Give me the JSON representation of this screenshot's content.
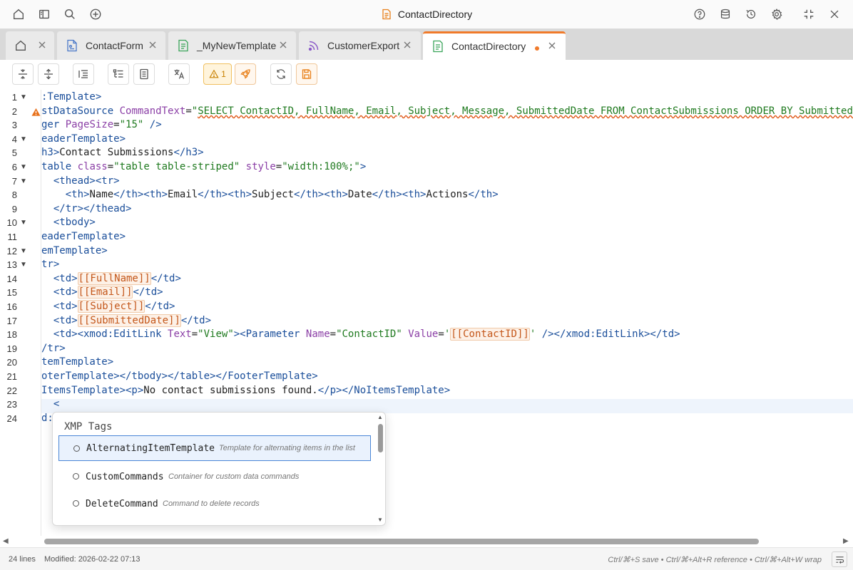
{
  "app": {
    "title": "ContactDirectory"
  },
  "tabs": [
    {
      "label": "",
      "icon": "home-icon"
    },
    {
      "label": "ContactForm",
      "icon": "form-icon"
    },
    {
      "label": "_MyNewTemplate",
      "icon": "template-icon"
    },
    {
      "label": "CustomerExport",
      "icon": "feed-icon"
    },
    {
      "label": "ContactDirectory",
      "icon": "template-icon",
      "active": true,
      "modified": true
    }
  ],
  "toolbar": {
    "warning_count": "1"
  },
  "editor": {
    "line_numbers": [
      "1",
      "2",
      "3",
      "4",
      "5",
      "6",
      "7",
      "8",
      "9",
      "10",
      "11",
      "12",
      "13",
      "14",
      "15",
      "16",
      "17",
      "18",
      "19",
      "20",
      "21",
      "22",
      "23",
      "24"
    ],
    "current_line": "23",
    "warning_line": "2"
  },
  "completion": {
    "title": "XMP Tags",
    "items": [
      {
        "name": "AlternatingItemTemplate",
        "description": "Template for alternating items in the list"
      },
      {
        "name": "CustomCommands",
        "description": "Container for custom data commands"
      },
      {
        "name": "DeleteCommand",
        "description": "Command to delete records"
      }
    ]
  },
  "status": {
    "lines": "24 lines",
    "modified": "Modified: 2026-02-22 07:13",
    "shortcuts": "Ctrl/⌘+S save • Ctrl/⌘+Alt+R reference • Ctrl/⌘+Alt+W wrap"
  },
  "colors": {
    "accent": "#f07a2a",
    "tag": "#1a4e9a",
    "attribute": "#8b3fa6",
    "string": "#1f7a1f",
    "token": "#c4571a"
  }
}
